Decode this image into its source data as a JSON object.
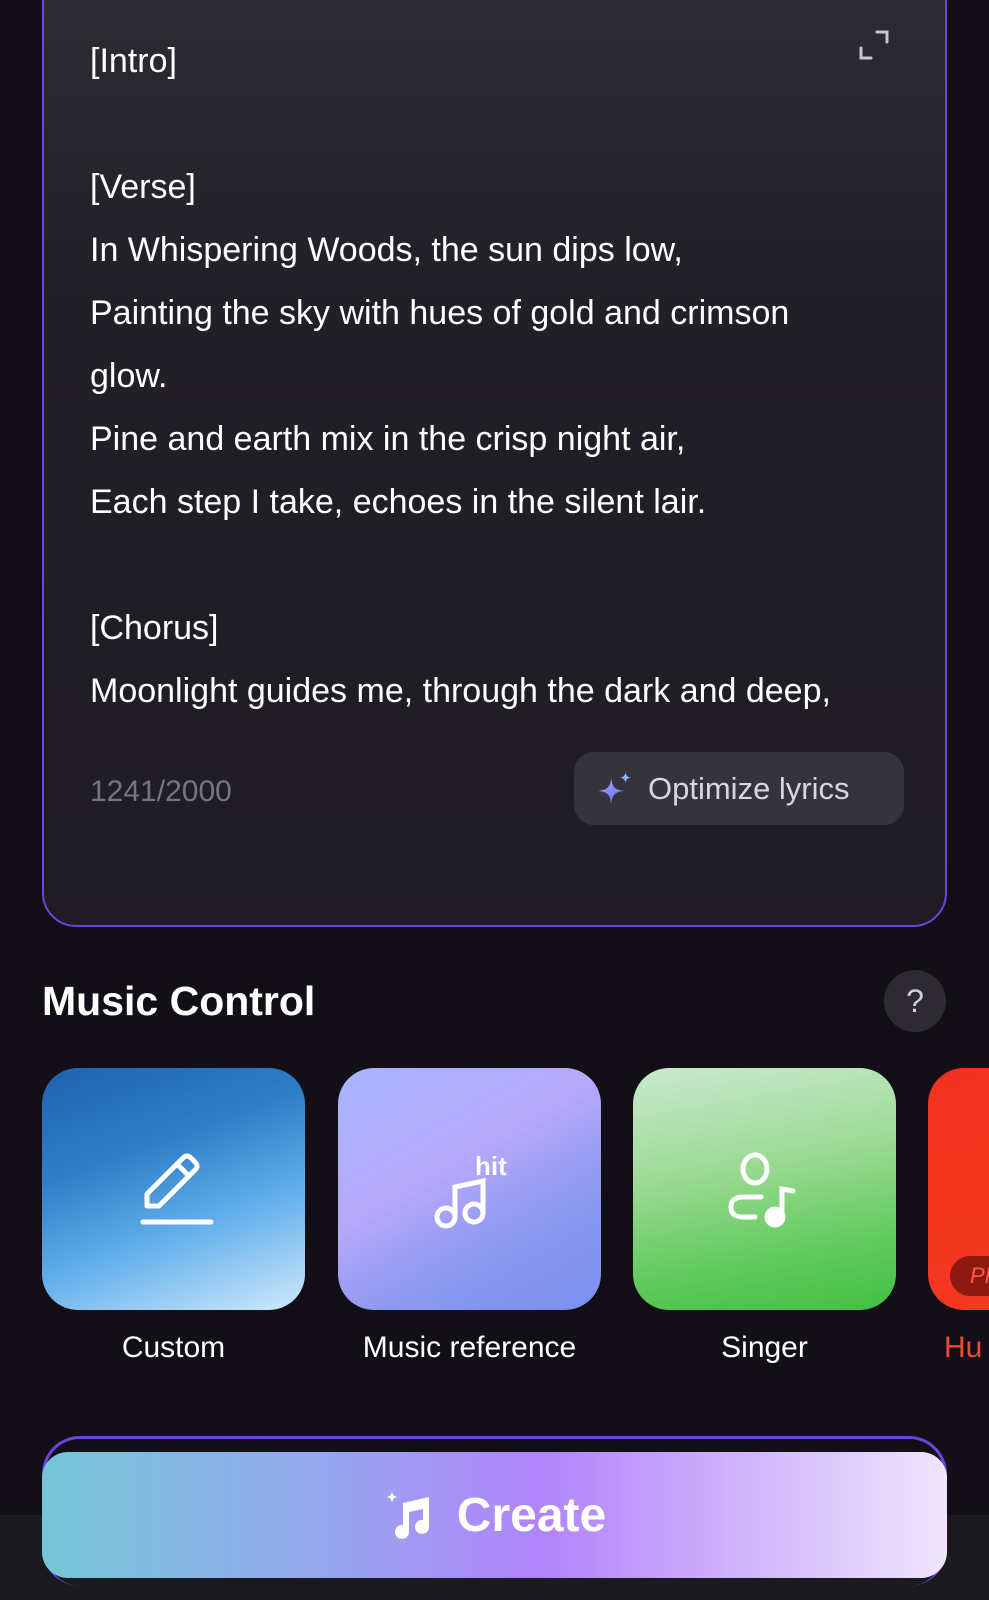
{
  "lyrics": {
    "text": "[Intro]\n\n[Verse]\nIn Whispering Woods, the sun dips low,\nPainting the sky with hues of gold and crimson glow.\nPine and earth mix in the crisp night air,\nEach step I take, echoes in the silent lair.\n\n[Chorus]\nMoonlight guides me, through the dark and deep,",
    "char_count": "1241/2000",
    "optimize_label": "Optimize lyrics"
  },
  "music_control": {
    "title": "Music Control",
    "help_label": "?",
    "tiles": [
      {
        "label": "Custom",
        "icon": "pencil-icon"
      },
      {
        "label": "Music reference",
        "icon": "hit-music-icon",
        "icon_text": "hit"
      },
      {
        "label": "Singer",
        "icon": "singer-icon"
      },
      {
        "label": "Hu",
        "icon": "hum-icon",
        "badge": "PR"
      }
    ]
  },
  "create": {
    "label": "Create"
  },
  "colors": {
    "background": "#121016",
    "accent_border": "#6a45e0",
    "hum_red": "#f2301d"
  }
}
